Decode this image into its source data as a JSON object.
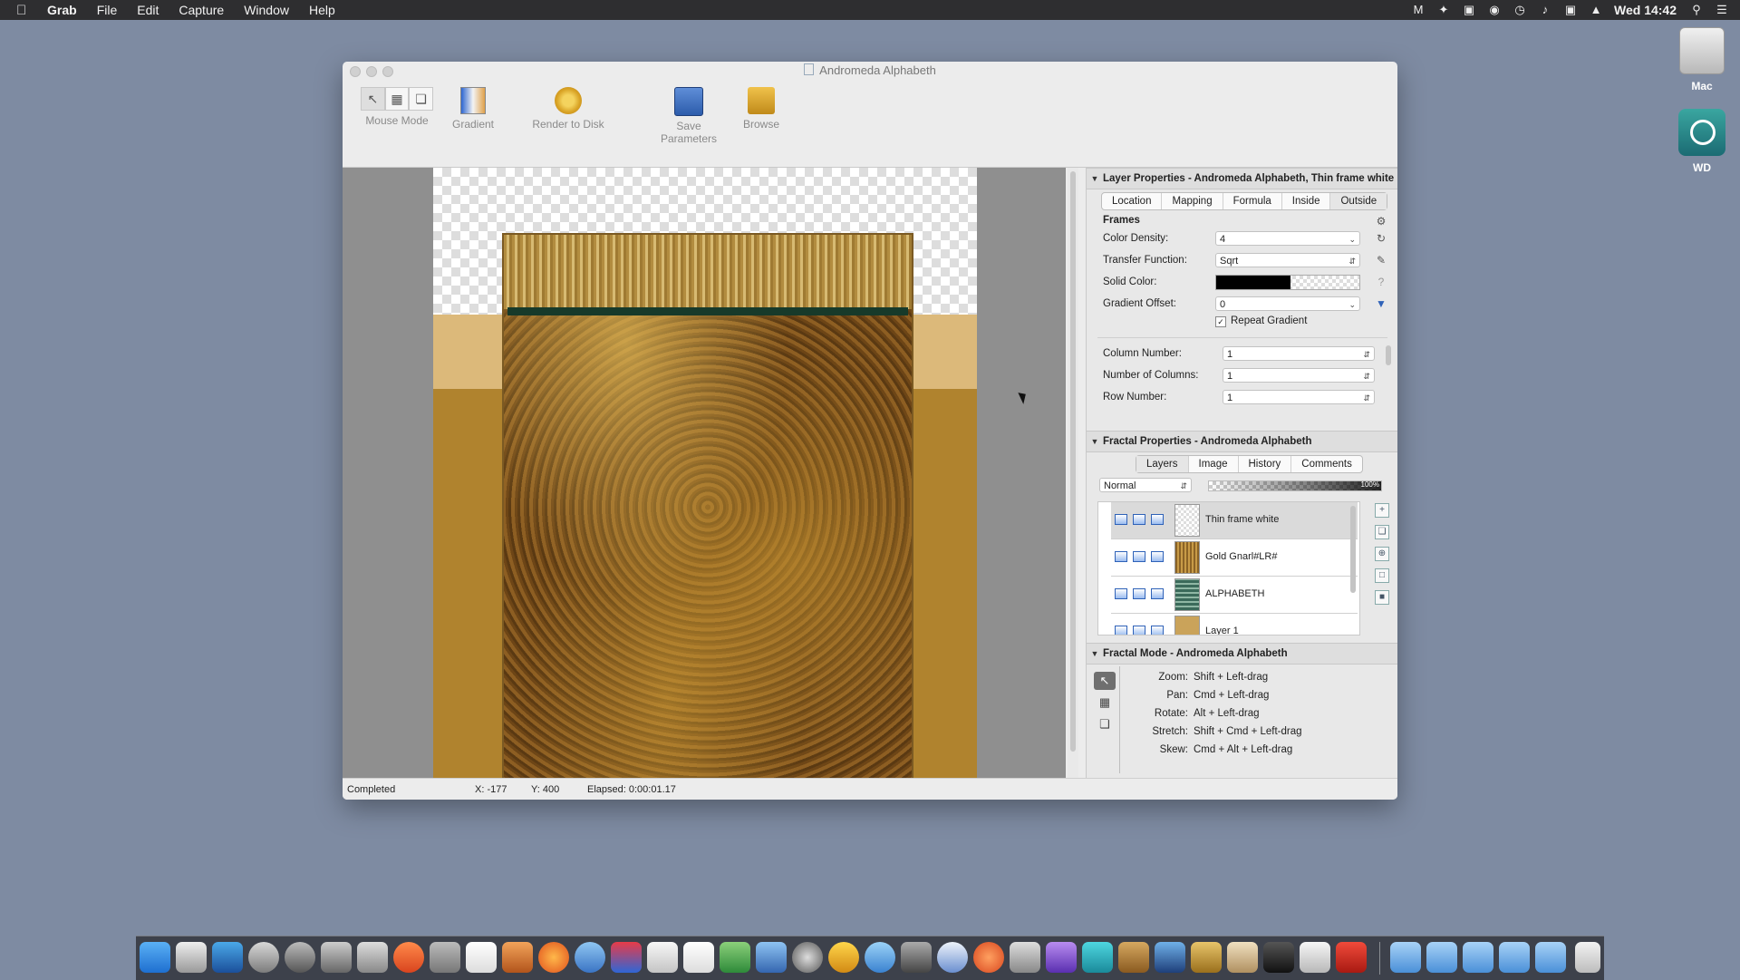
{
  "menubar": {
    "apple": "",
    "app_name": "Grab",
    "menus": [
      "File",
      "Edit",
      "Capture",
      "Window",
      "Help"
    ],
    "clock": "Wed 14:42"
  },
  "desktop": {
    "icons": [
      {
        "label": "Mac"
      },
      {
        "label": "WD"
      }
    ]
  },
  "window": {
    "title": "Andromeda Alphabeth",
    "toolbar": {
      "mouse_mode": "Mouse Mode",
      "gradient": "Gradient",
      "render": "Render to Disk",
      "save_params": "Save Parameters",
      "browse": "Browse"
    },
    "status": {
      "state": "Completed",
      "x": "X: -177",
      "y": "Y: 400",
      "elapsed": "Elapsed: 0:00:01.17"
    }
  },
  "layer_properties": {
    "header": "Layer Properties - Andromeda Alphabeth, Thin frame white",
    "tabs": [
      "Location",
      "Mapping",
      "Formula",
      "Inside",
      "Outside"
    ],
    "section_title": "Frames",
    "color_density_label": "Color Density:",
    "color_density": "4",
    "transfer_function_label": "Transfer Function:",
    "transfer_function": "Sqrt",
    "solid_color_label": "Solid Color:",
    "gradient_offset_label": "Gradient Offset:",
    "gradient_offset": "0",
    "repeat_gradient_label": "Repeat Gradient",
    "column_number_label": "Column Number:",
    "column_number": "1",
    "number_of_columns_label": "Number of Columns:",
    "number_of_columns": "1",
    "row_number_label": "Row Number:",
    "row_number": "1",
    "help_glyph": "?"
  },
  "fractal_properties": {
    "header": "Fractal Properties - Andromeda Alphabeth",
    "tabs": [
      "Layers",
      "Image",
      "History",
      "Comments"
    ],
    "blend_mode": "Normal",
    "opacity": "100%",
    "layers": [
      {
        "name": "Thin frame white"
      },
      {
        "name": "Gold Gnarl#LR#"
      },
      {
        "name": "ALPHABETH"
      },
      {
        "name": "Layer 1"
      }
    ]
  },
  "fractal_mode": {
    "header": "Fractal Mode - Andromeda Alphabeth",
    "rows": [
      {
        "key": "Zoom:",
        "value": "Shift + Left-drag"
      },
      {
        "key": "Pan:",
        "value": "Cmd + Left-drag"
      },
      {
        "key": "Rotate:",
        "value": "Alt + Left-drag"
      },
      {
        "key": "Stretch:",
        "value": "Shift + Cmd + Left-drag"
      },
      {
        "key": "Skew:",
        "value": "Cmd + Alt + Left-drag"
      }
    ]
  },
  "colors": {
    "desktop": "#7e8ba2",
    "menubar": "#2e2e30",
    "accent_blue": "#2f62b8"
  }
}
